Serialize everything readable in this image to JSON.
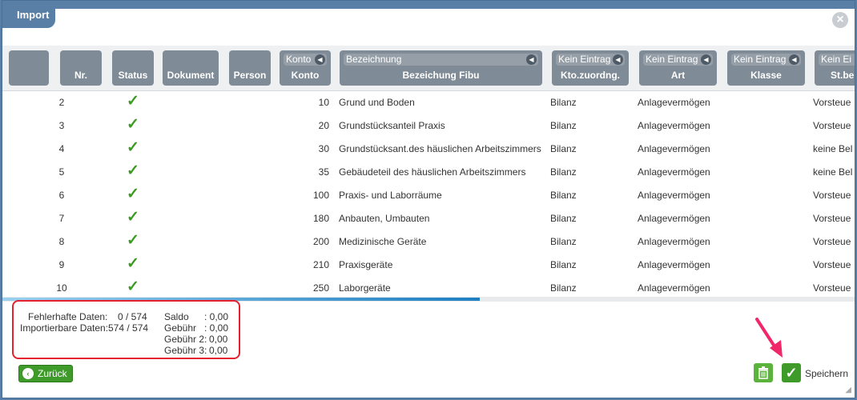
{
  "window": {
    "title": "Import",
    "close_icon": "close-icon"
  },
  "columns": {
    "nr": "Nr.",
    "status": "Status",
    "dokument": "Dokument",
    "person": "Person",
    "konto": {
      "filter": "Konto",
      "label": "Konto"
    },
    "bezeichnung": {
      "filter": "Bezeichnung",
      "label": "Bezeichung Fibu"
    },
    "kto": {
      "filter": "Kein Eintrag",
      "label": "Kto.zuordng."
    },
    "art": {
      "filter": "Kein Eintrag",
      "label": "Art"
    },
    "klasse": {
      "filter": "Kein Eintrag",
      "label": "Klasse"
    },
    "st": {
      "filter": "Kein Ei",
      "label": "St.be"
    }
  },
  "rows": [
    {
      "nr": "2",
      "status": "✓",
      "konto": "10",
      "bez": "Grund und Boden",
      "kto": "Bilanz",
      "art": "Anlagevermögen",
      "st": "Vorsteue"
    },
    {
      "nr": "3",
      "status": "✓",
      "konto": "20",
      "bez": "Grundstücksanteil Praxis",
      "kto": "Bilanz",
      "art": "Anlagevermögen",
      "st": "Vorsteue"
    },
    {
      "nr": "4",
      "status": "✓",
      "konto": "30",
      "bez": "Grundstücksant.des häuslichen Arbeitszimmers",
      "kto": "Bilanz",
      "art": "Anlagevermögen",
      "st": "keine Bel"
    },
    {
      "nr": "5",
      "status": "✓",
      "konto": "35",
      "bez": "Gebäudeteil des häuslichen Arbeitszimmers",
      "kto": "Bilanz",
      "art": "Anlagevermögen",
      "st": "keine Bel"
    },
    {
      "nr": "6",
      "status": "✓",
      "konto": "100",
      "bez": "Praxis- und Laborräume",
      "kto": "Bilanz",
      "art": "Anlagevermögen",
      "st": "Vorsteue"
    },
    {
      "nr": "7",
      "status": "✓",
      "konto": "180",
      "bez": "Anbauten, Umbauten",
      "kto": "Bilanz",
      "art": "Anlagevermögen",
      "st": "Vorsteue"
    },
    {
      "nr": "8",
      "status": "✓",
      "konto": "200",
      "bez": "Medizinische Geräte",
      "kto": "Bilanz",
      "art": "Anlagevermögen",
      "st": "Vorsteue"
    },
    {
      "nr": "9",
      "status": "✓",
      "konto": "210",
      "bez": "Praxisgeräte",
      "kto": "Bilanz",
      "art": "Anlagevermögen",
      "st": "Vorsteue"
    },
    {
      "nr": "10",
      "status": "✓",
      "konto": "250",
      "bez": "Laborgeräte",
      "kto": "Bilanz",
      "art": "Anlagevermögen",
      "st": "Vorsteue"
    }
  ],
  "summary": {
    "fehler_label": "Fehlerhafte Daten:",
    "fehler_value": "0 / 574",
    "import_label": "Importierbare Daten:",
    "import_value": "574 / 574",
    "saldo_label": "Saldo",
    "saldo_value": ": 0,00",
    "gebuehr_label": "Gebühr",
    "gebuehr_value": ": 0,00",
    "gebuehr2_label": "Gebühr 2:",
    "gebuehr2_value": "0,00",
    "gebuehr3_label": "Gebühr 3:",
    "gebuehr3_value": "0,00"
  },
  "footer": {
    "back_label": "Zurück",
    "save_label": "Speichern"
  },
  "colors": {
    "accent": "#5a7fa6",
    "success": "#3e9b2a",
    "highlight": "#e52030",
    "pointer": "#f0286a"
  }
}
